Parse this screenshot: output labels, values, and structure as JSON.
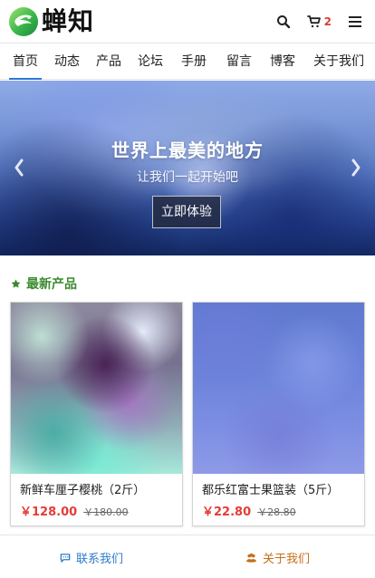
{
  "header": {
    "brand": "蝉知",
    "cart_count": "2",
    "icons": {
      "logo": "logo-icon",
      "search": "search-icon",
      "cart": "cart-icon",
      "menu": "menu-icon"
    },
    "colors": {
      "cart_count": "#d43f3a"
    }
  },
  "nav": {
    "items": [
      {
        "label": "首页",
        "active": true
      },
      {
        "label": "动态"
      },
      {
        "label": "产品"
      },
      {
        "label": "论坛"
      },
      {
        "label": "手册"
      },
      {
        "label": "留言"
      },
      {
        "label": "博客"
      },
      {
        "label": "关于我们"
      }
    ],
    "active_color": "#2f74d0"
  },
  "hero": {
    "title": "世界上最美的地方",
    "subtitle": "让我们一起开始吧",
    "button_label": "立即体验",
    "icons": {
      "left": "chevron-left-icon",
      "right": "chevron-right-icon"
    }
  },
  "section": {
    "title": "最新产品",
    "icon": "star-icon",
    "color": "#3b8a2e"
  },
  "products": [
    {
      "name": "新鲜车厘子樱桃（2斤）",
      "price": "￥128.00",
      "old_price": "￥180.00"
    },
    {
      "name": "都乐红富士果篮装（5斤）",
      "price": "￥22.80",
      "old_price": "￥28.80"
    }
  ],
  "footer": {
    "contact_label": "联系我们",
    "about_label": "关于我们",
    "icons": {
      "contact": "chat-icon",
      "about": "users-icon"
    },
    "colors": {
      "contact": "#2f7cc7",
      "about": "#c56f19"
    }
  }
}
